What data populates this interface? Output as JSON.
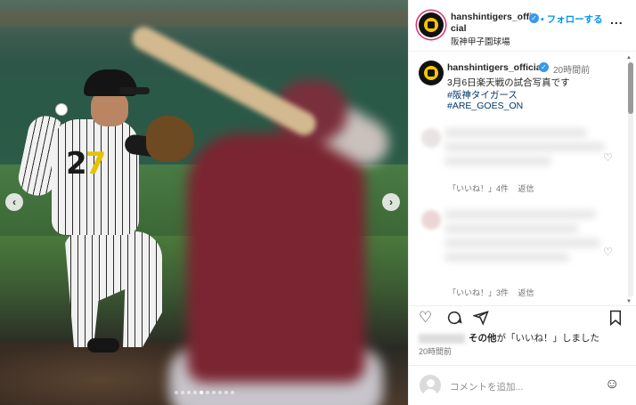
{
  "post": {
    "photo": {
      "carousel_total": 10,
      "carousel_active": 4
    },
    "header": {
      "username": "hanshintigers_official",
      "follow_label": "フォローする",
      "separator": "•",
      "location": "阪神甲子園球場",
      "more": "..."
    },
    "caption": {
      "username": "hanshintigers_official",
      "time": "20時間前",
      "text": "3月6日楽天戦の試合写真です",
      "hashtags": [
        "#阪神タイガース",
        "#ARE_GOES_ON"
      ]
    },
    "comments": [
      {
        "likes": "「いいね！」4件",
        "reply": "返信"
      },
      {
        "likes": "「いいね！」3件",
        "reply": "返信"
      }
    ],
    "likes_line": {
      "others": "その他",
      "suffix": "が「いいね！」しました"
    },
    "post_time": "20時間前",
    "add_comment": {
      "placeholder": "コメントを追加..."
    }
  },
  "icons": {
    "verified": "verified-badge-icon",
    "heart": "heart-icon",
    "comment": "comment-icon",
    "share": "share-icon",
    "bookmark": "bookmark-icon",
    "emoji": "emoji-icon",
    "prev": "chevron-left-icon",
    "next": "chevron-right-icon"
  },
  "colors": {
    "link": "#0095f6",
    "hashtag": "#00376b",
    "verified": "#3897f0",
    "muted": "#737373"
  }
}
